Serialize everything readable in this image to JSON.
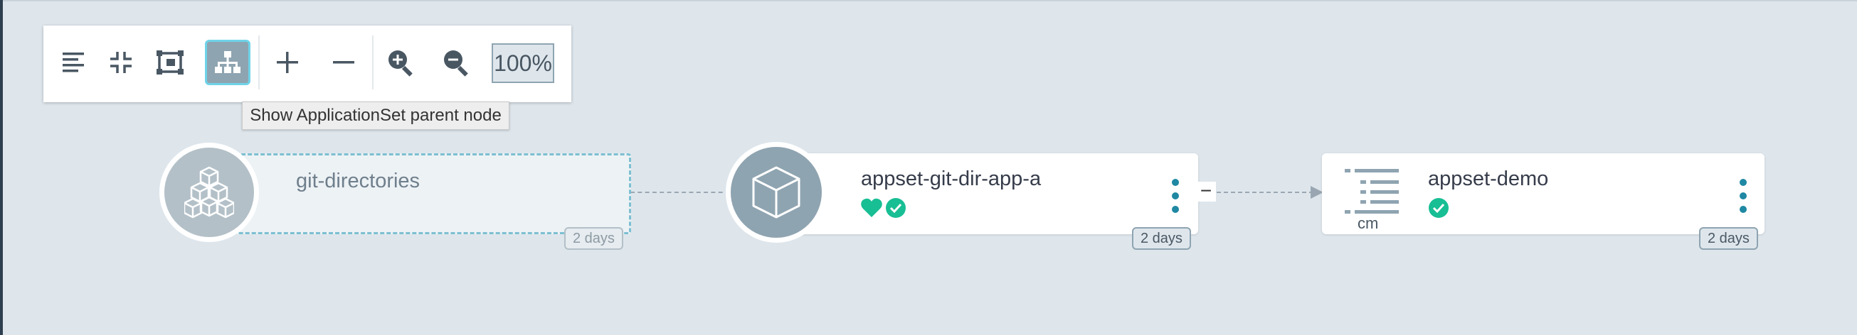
{
  "toolbar": {
    "buttons": [
      {
        "icon": "list-view-icon"
      },
      {
        "icon": "compact-view-icon"
      },
      {
        "icon": "fit-view-icon"
      },
      {
        "icon": "applicationset-tree-icon",
        "active": true
      },
      {
        "icon": "plus-icon"
      },
      {
        "icon": "minus-icon"
      },
      {
        "icon": "zoom-in-icon"
      },
      {
        "icon": "zoom-out-icon"
      }
    ],
    "zoom": "100%"
  },
  "tooltip": "Show ApplicationSet parent node",
  "nodes": {
    "appset": {
      "name": "git-directories",
      "age": "2 days",
      "icon": "cubes-icon"
    },
    "app": {
      "name": "appset-git-dir-app-a",
      "age": "2 days",
      "icon": "cube-icon",
      "health": "healthy",
      "sync": "synced"
    },
    "configmap": {
      "name": "appset-demo",
      "kind": "cm",
      "age": "2 days",
      "icon": "configmap-icon",
      "sync": "synced"
    }
  },
  "colors": {
    "healthy": "#18be94",
    "accent": "#1f88a3",
    "selected_border": "#6fd3e8",
    "node_icon_bg": "#8fa4b1"
  }
}
